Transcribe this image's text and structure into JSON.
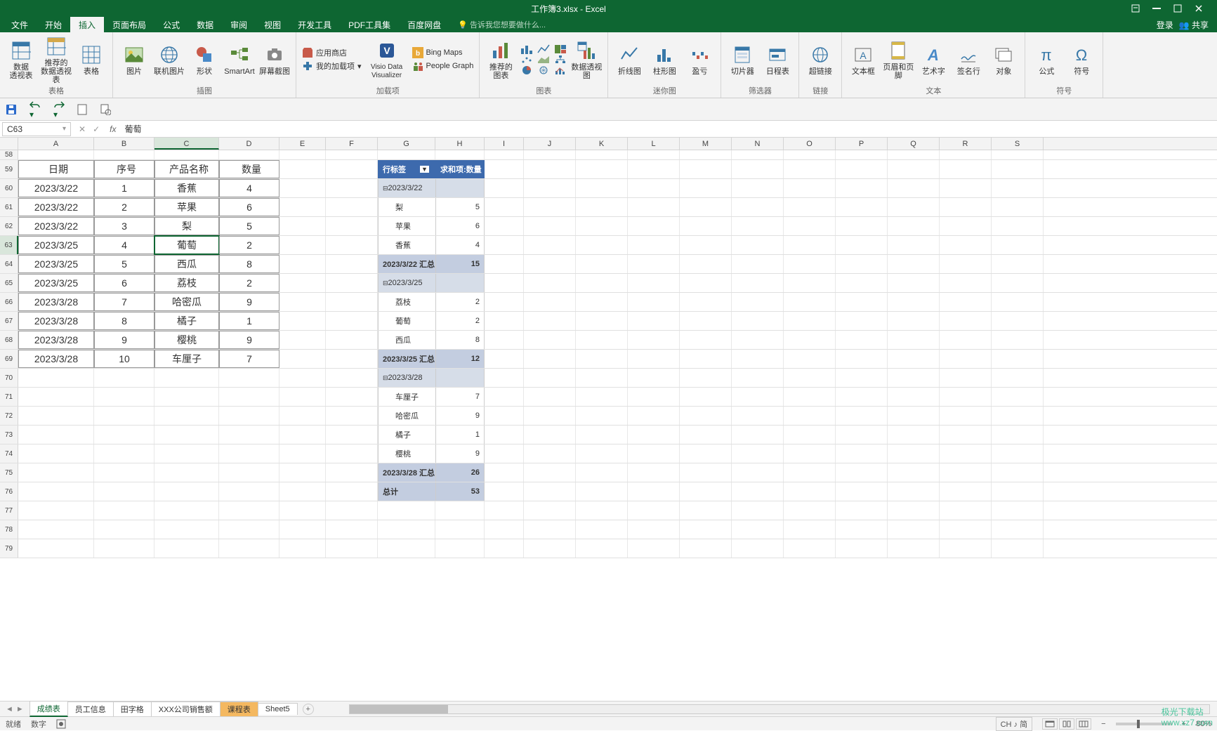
{
  "window": {
    "title": "工作簿3.xlsx - Excel",
    "login": "登录",
    "share": "共享"
  },
  "menu": {
    "file": "文件",
    "home": "开始",
    "insert": "插入",
    "pageLayout": "页面布局",
    "formulas": "公式",
    "data": "数据",
    "review": "审阅",
    "view": "视图",
    "devtools": "开发工具",
    "pdf": "PDF工具集",
    "baidu": "百度网盘",
    "tellme": "告诉我您想要做什么..."
  },
  "ribbon": {
    "g_tables": {
      "pivot": "数据\n透视表",
      "recpivot": "推荐的\n数据透视表",
      "table": "表格",
      "name": "表格"
    },
    "g_illus": {
      "pic": "图片",
      "online": "联机图片",
      "shapes": "形状",
      "smartart": "SmartArt",
      "screenshot": "屏幕截图",
      "name": "插图"
    },
    "g_addins": {
      "store": "应用商店",
      "myaddins": "我的加载项",
      "visio": "Visio Data\nVisualizer",
      "bingmaps": "Bing Maps",
      "pgraph": "People Graph",
      "name": "加载项"
    },
    "g_charts": {
      "recchart": "推荐的\n图表",
      "pivotchart": "数据透视图",
      "name": "图表"
    },
    "g_spark": {
      "line": "折线图",
      "col": "柱形图",
      "winloss": "盈亏",
      "name": "迷你图"
    },
    "g_filter": {
      "slicer": "切片器",
      "timeline": "日程表",
      "name": "筛选器"
    },
    "g_links": {
      "hyperlink": "超链接",
      "name": "链接"
    },
    "g_text": {
      "textbox": "文本框",
      "headerfooter": "页眉和页脚",
      "wordart": "艺术字",
      "sigline": "签名行",
      "object": "对象",
      "name": "文本"
    },
    "g_symbols": {
      "equation": "公式",
      "symbol": "符号",
      "name": "符号"
    }
  },
  "namebox": "C63",
  "fx": "fx",
  "formulaValue": "葡萄",
  "cols": [
    "A",
    "B",
    "C",
    "D",
    "E",
    "F",
    "G",
    "H",
    "I",
    "J",
    "K",
    "L",
    "M",
    "N",
    "O",
    "P",
    "Q",
    "R",
    "S"
  ],
  "rowlabels": [
    "58",
    "59",
    "60",
    "61",
    "62",
    "63",
    "64",
    "65",
    "66",
    "67",
    "68",
    "69",
    "70",
    "71",
    "72",
    "73",
    "74",
    "75",
    "76",
    "77",
    "78",
    "79"
  ],
  "table": {
    "headers": {
      "date": "日期",
      "seq": "序号",
      "product": "产品名称",
      "qty": "数量"
    },
    "rows": [
      {
        "date": "2023/3/22",
        "seq": "1",
        "product": "香蕉",
        "qty": "4"
      },
      {
        "date": "2023/3/22",
        "seq": "2",
        "product": "苹果",
        "qty": "6"
      },
      {
        "date": "2023/3/22",
        "seq": "3",
        "product": "梨",
        "qty": "5"
      },
      {
        "date": "2023/3/25",
        "seq": "4",
        "product": "葡萄",
        "qty": "2"
      },
      {
        "date": "2023/3/25",
        "seq": "5",
        "product": "西瓜",
        "qty": "8"
      },
      {
        "date": "2023/3/25",
        "seq": "6",
        "product": "荔枝",
        "qty": "2"
      },
      {
        "date": "2023/3/28",
        "seq": "7",
        "product": "哈密瓜",
        "qty": "9"
      },
      {
        "date": "2023/3/28",
        "seq": "8",
        "product": "橘子",
        "qty": "1"
      },
      {
        "date": "2023/3/28",
        "seq": "9",
        "product": "樱桃",
        "qty": "9"
      },
      {
        "date": "2023/3/28",
        "seq": "10",
        "product": "车厘子",
        "qty": "7"
      }
    ]
  },
  "pivot": {
    "hdr_label": "行标签",
    "hdr_sum": "求和项:数量",
    "rows": [
      {
        "type": "grouphd",
        "g": "2023/3/22",
        "h": ""
      },
      {
        "type": "item",
        "g": "梨",
        "h": "5"
      },
      {
        "type": "item",
        "g": "苹果",
        "h": "6"
      },
      {
        "type": "item",
        "g": "香蕉",
        "h": "4"
      },
      {
        "type": "subtotal",
        "g": "2023/3/22 汇总",
        "h": "15"
      },
      {
        "type": "grouphd",
        "g": "2023/3/25",
        "h": ""
      },
      {
        "type": "item",
        "g": "荔枝",
        "h": "2"
      },
      {
        "type": "item",
        "g": "葡萄",
        "h": "2"
      },
      {
        "type": "item",
        "g": "西瓜",
        "h": "8"
      },
      {
        "type": "subtotal",
        "g": "2023/3/25 汇总",
        "h": "12"
      },
      {
        "type": "grouphd",
        "g": "2023/3/28",
        "h": ""
      },
      {
        "type": "item",
        "g": "车厘子",
        "h": "7"
      },
      {
        "type": "item",
        "g": "哈密瓜",
        "h": "9"
      },
      {
        "type": "item",
        "g": "橘子",
        "h": "1"
      },
      {
        "type": "item",
        "g": "樱桃",
        "h": "9"
      },
      {
        "type": "subtotal",
        "g": "2023/3/28 汇总",
        "h": "26"
      },
      {
        "type": "total",
        "g": "总计",
        "h": "53"
      }
    ]
  },
  "sheets": {
    "s1": "成绩表",
    "s2": "员工信息",
    "s3": "田字格",
    "s4": "XXX公司销售额",
    "s5": "课程表",
    "s6": "Sheet5"
  },
  "status": {
    "ready": "就绪",
    "num": "数字",
    "ime": "CH ♪ 简",
    "zoom": "80%"
  },
  "watermark": {
    "l1": "极光下载站",
    "l2": "www.xz7.com"
  }
}
